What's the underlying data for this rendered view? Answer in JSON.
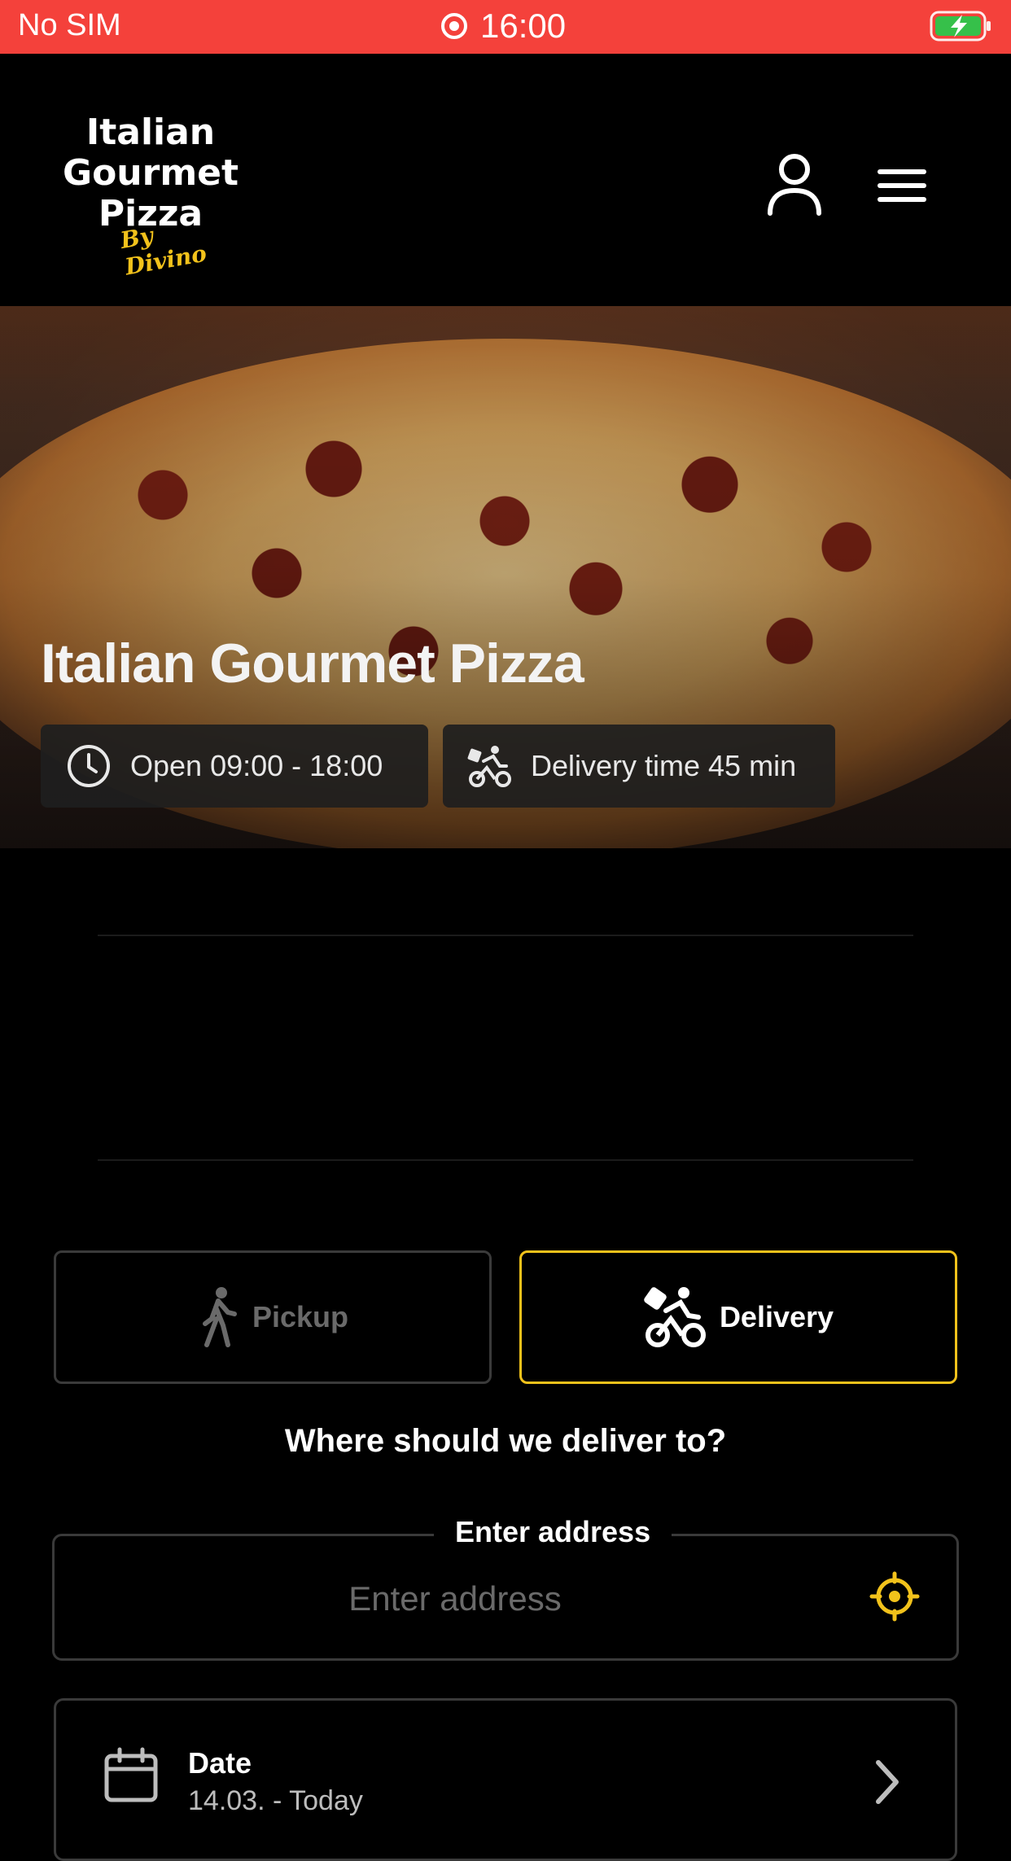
{
  "status_bar": {
    "carrier": "No SIM",
    "time": "16:00",
    "bg_color": "#f4413b"
  },
  "header": {
    "logo_lines": [
      "Italian",
      "Gourmet",
      "Pizza"
    ],
    "logo_script": "By Divino",
    "account_icon": "user-icon",
    "menu_icon": "hamburger-menu-icon"
  },
  "hero": {
    "title": "Italian Gourmet Pizza",
    "hours_text": "Open 09:00 - 18:00",
    "delivery_time_text": "Delivery time 45 min"
  },
  "order_mode": {
    "pickup_label": "Pickup",
    "delivery_label": "Delivery",
    "selected": "delivery",
    "accent_color": "#f2c21b"
  },
  "delivery_question": "Where should we deliver to?",
  "address": {
    "legend": "Enter address",
    "placeholder": "Enter address",
    "value": ""
  },
  "date": {
    "label": "Date",
    "value": "14.03. - Today"
  }
}
